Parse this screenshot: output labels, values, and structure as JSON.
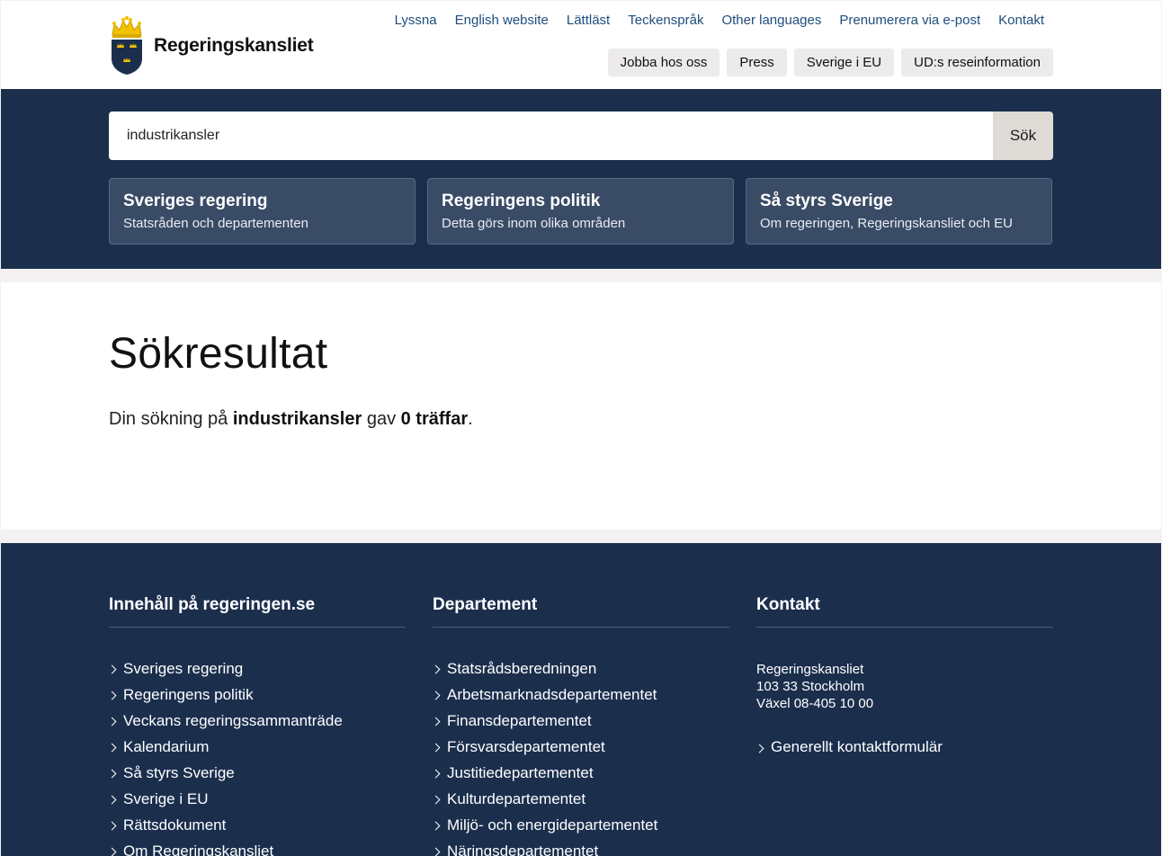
{
  "header": {
    "logo_text": "Regeringskansliet",
    "top_links": [
      "Lyssna",
      "English website",
      "Lättläst",
      "Teckenspråk",
      "Other languages",
      "Prenumerera via e-post",
      "Kontakt"
    ],
    "top_buttons": [
      "Jobba hos oss",
      "Press",
      "Sverige i EU",
      "UD:s reseinformation"
    ]
  },
  "search": {
    "value": "industrikansler",
    "button_label": "Sök"
  },
  "cards": [
    {
      "title": "Sveriges regering",
      "subtitle": "Statsråden och departementen"
    },
    {
      "title": "Regeringens politik",
      "subtitle": "Detta görs inom olika områden"
    },
    {
      "title": "Så styrs Sverige",
      "subtitle": "Om regeringen, Regeringskansliet och EU"
    }
  ],
  "main": {
    "heading": "Sökresultat",
    "summary_prefix": "Din sökning på ",
    "summary_term": "industrikansler",
    "summary_middle": " gav ",
    "summary_hits": "0 träffar",
    "summary_suffix": "."
  },
  "footer": {
    "col1": {
      "title": "Innehåll på regeringen.se",
      "items": [
        "Sveriges regering",
        "Regeringens politik",
        "Veckans regeringssammanträde",
        "Kalendarium",
        "Så styrs Sverige",
        "Sverige i EU",
        "Rättsdokument",
        "Om Regeringskansliet"
      ]
    },
    "col2": {
      "title": "Departement",
      "items": [
        "Statsrådsberedningen",
        "Arbetsmarknadsdepartementet",
        "Finansdepartementet",
        "Försvarsdepartementet",
        "Justitiedepartementet",
        "Kulturdepartementet",
        "Miljö- och energidepartementet",
        "Näringsdepartementet"
      ]
    },
    "col3": {
      "title": "Kontakt",
      "address": [
        "Regeringskansliet",
        "103 33 Stockholm",
        "Växel 08-405 10 00"
      ],
      "link": "Generellt kontaktformulär"
    }
  },
  "colors": {
    "brand_navy": "#1b2f4d",
    "link_blue": "#1f4d7d",
    "crown_gold": "#f2c200"
  }
}
